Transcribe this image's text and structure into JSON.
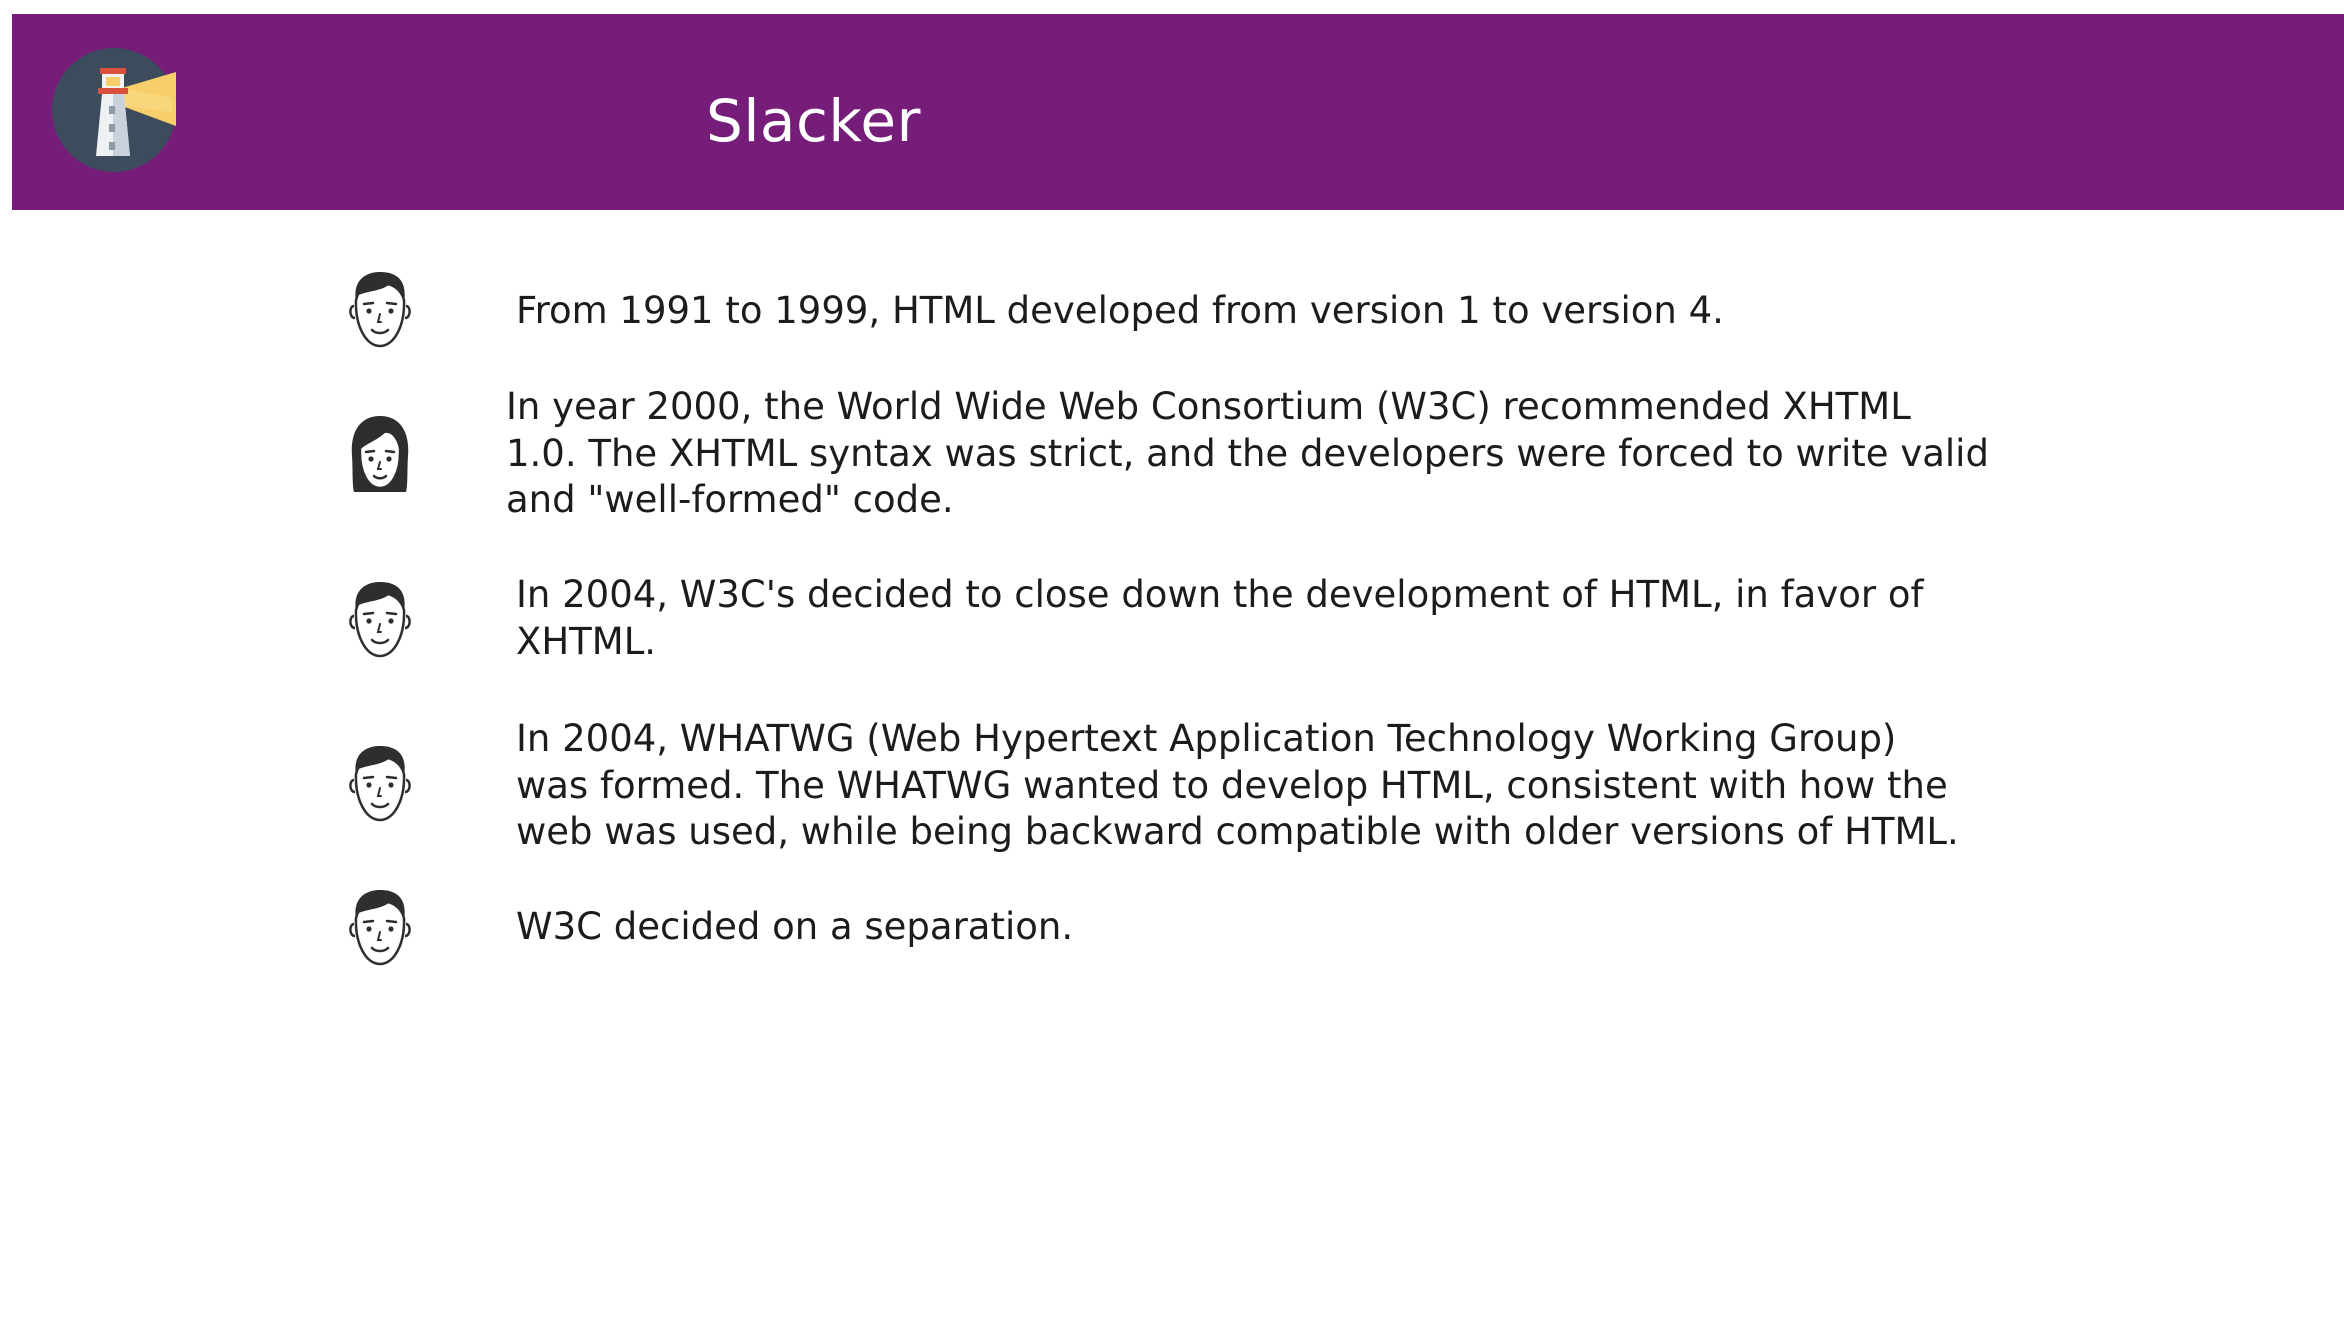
{
  "header": {
    "title": "Slacker",
    "logo_icon": "lighthouse-icon",
    "background_color": "#761d7a"
  },
  "messages": [
    {
      "avatar": "male-avatar-icon",
      "lines": [
        "From 1991 to 1999, HTML developed from version 1 to version 4."
      ]
    },
    {
      "avatar": "female-avatar-icon",
      "lines": [
        "In year 2000, the World Wide Web Consortium (W3C) recommended XHTML",
        "1.0. The XHTML syntax was strict, and the developers were forced to write valid",
        "and \"well-formed\" code."
      ]
    },
    {
      "avatar": "male-avatar-icon",
      "lines": [
        "In 2004, W3C's decided to close down the development of HTML, in favor of",
        "XHTML."
      ]
    },
    {
      "avatar": "male-avatar-icon",
      "lines": [
        "In 2004, WHATWG (Web Hypertext Application Technology Working Group)",
        "was formed. The WHATWG wanted to develop HTML, consistent with how the",
        "web was used, while being backward compatible with older versions of HTML."
      ]
    },
    {
      "avatar": "male-avatar-icon",
      "lines": [
        "W3C decided on a separation."
      ]
    }
  ]
}
